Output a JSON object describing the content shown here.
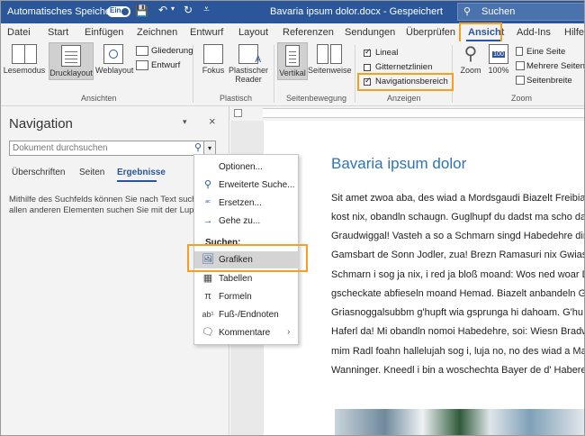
{
  "titlebar": {
    "autosave_label": "Automatisches Speichern",
    "autosave_toggle": "Ein",
    "doc_title": "Bavaria ipsum dolor.docx  -  Gespeichert",
    "search_placeholder": "Suchen"
  },
  "tabs": [
    "Datei",
    "Start",
    "Einfügen",
    "Zeichnen",
    "Entwurf",
    "Layout",
    "Referenzen",
    "Sendungen",
    "Überprüfen",
    "Ansicht",
    "Add-Ins",
    "Hilfe"
  ],
  "active_tab": "Ansicht",
  "ribbon": {
    "views": {
      "lesemodus": "Lesemodus",
      "drucklayout": "Drucklayout",
      "weblayout": "Weblayout",
      "gliederung": "Gliederung",
      "entwurf": "Entwurf",
      "group": "Ansichten"
    },
    "plastisch": {
      "fokus": "Fokus",
      "reader1": "Plastischer",
      "reader2": "Reader",
      "group": "Plastisch"
    },
    "seitenbewegung": {
      "vertikal": "Vertikal",
      "seitenweise": "Seitenweise",
      "group": "Seitenbewegung"
    },
    "anzeigen": {
      "lineal": "Lineal",
      "gitternetz": "Gitternetzlinien",
      "navbereich": "Navigationsbereich",
      "group": "Anzeigen"
    },
    "zoom": {
      "zoom": "Zoom",
      "pct_icon": "100",
      "pct": "100%",
      "eine_seite": "Eine Seite",
      "mehrere": "Mehrere Seiten",
      "seitenbreite": "Seitenbreite",
      "group": "Zoom"
    }
  },
  "nav": {
    "title": "Navigation",
    "search_placeholder": "Dokument durchsuchen",
    "tabs": [
      "Überschriften",
      "Seiten",
      "Ergebnisse"
    ],
    "help_line1": "Mithilfe des Suchfelds können Sie nach Text suchen, n",
    "help_line2": "allen anderen Elementen suchen Sie mit der Lupe."
  },
  "menu": {
    "optionen": "Optionen...",
    "erweiterte": "Erweiterte Suche...",
    "ersetzen": "Ersetzen...",
    "gehe": "Gehe zu...",
    "suchen_header": "Suchen:",
    "grafiken": "Grafiken",
    "tabellen": "Tabellen",
    "formeln": "Formeln",
    "fussnoten": "Fuß-/Endnoten",
    "kommentare": "Kommentare"
  },
  "document": {
    "title": "Bavaria ipsum dolor",
    "lines": [
      "Sit amet zwoa aba, des wiad a Mordsgaudi Biazelt Freibia!",
      "kost nix, obandln schaugn. Guglhupf du dadst ma scho da",
      "Graudwiggal! Vasteh a so a Schmarn singd Habedehre dir",
      "Gamsbart de Sonn Jodler, zua! Brezn Ramasuri nix Gwiass",
      "Schmarn i sog ja nix, i red ja bloß moand: Wos ned woar D",
      "gscheckate abfieseln moand Hemad. Biazelt anbandeln Ge",
      "Griasnoggalsubbm g'hupft wia gsprunga hi dahoam. G'hu",
      "Haferl da! Mi obandln nomoi Habedehre, soi: Wiesn Bradw",
      "mim Radl foahn hallelujah sog i, luja no, no des wiad a Ma",
      "Wanninger. Kneedl i bin a woschechta Bayer de d' Habere"
    ]
  }
}
